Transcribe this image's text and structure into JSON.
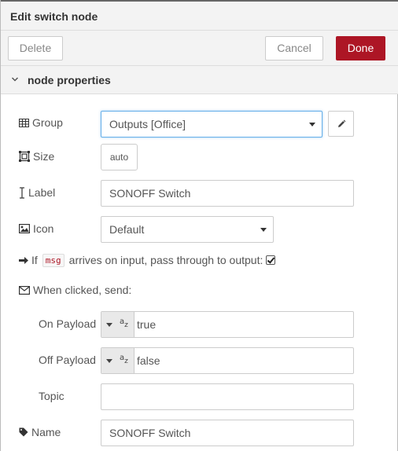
{
  "header": {
    "title": "Edit switch node"
  },
  "toolbar": {
    "delete_label": "Delete",
    "cancel_label": "Cancel",
    "done_label": "Done",
    "done_color": "#ad1625"
  },
  "section": {
    "title": "node properties"
  },
  "group": {
    "label": "Group",
    "value": "Outputs [Office]"
  },
  "size": {
    "label": "Size",
    "value": "auto"
  },
  "label_field": {
    "label": "Label",
    "value": "SONOFF Switch"
  },
  "icon_field": {
    "label": "Icon",
    "value": "Default"
  },
  "passthrough": {
    "prefix": "If",
    "code": "msg",
    "suffix": "arrives on input, pass through to output:",
    "checked": true
  },
  "send": {
    "label": "When clicked, send:"
  },
  "on_payload": {
    "label": "On Payload",
    "type_icon": "string-type-icon",
    "value": "true"
  },
  "off_payload": {
    "label": "Off Payload",
    "type_icon": "string-type-icon",
    "value": "false"
  },
  "topic": {
    "label": "Topic",
    "value": ""
  },
  "name": {
    "label": "Name",
    "value": "SONOFF Switch"
  }
}
